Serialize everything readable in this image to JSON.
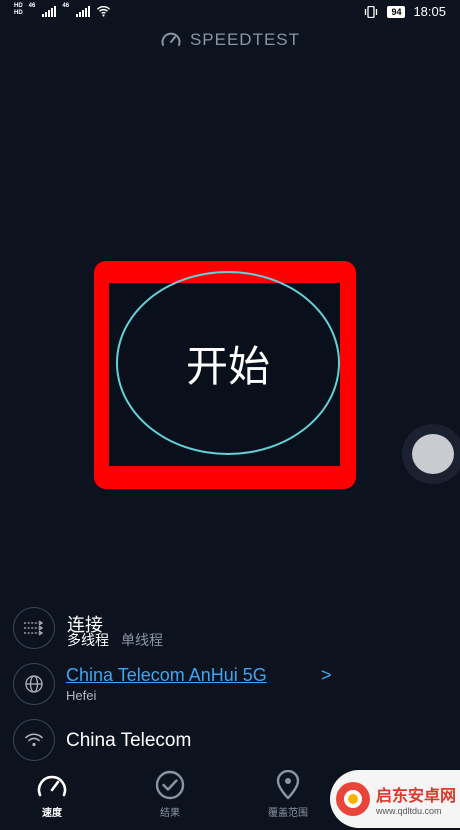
{
  "status_bar": {
    "network_left": [
      "HD",
      "46"
    ],
    "network_right": [
      "46"
    ],
    "battery": "94",
    "time": "18:05"
  },
  "brand": {
    "title": "SPEEDTEST",
    "icon": "gauge-icon"
  },
  "start_button": {
    "label": "开始",
    "ring_color": "#63d1d6"
  },
  "highlight_box_color": "#ff0000",
  "connection": {
    "title": "连接",
    "options": [
      {
        "label": "多线程",
        "active": true
      },
      {
        "label": "单线程",
        "active": false
      }
    ]
  },
  "server": {
    "name": "China Telecom AnHui 5G",
    "chevron": ">",
    "city": "Hefei",
    "link_color": "#3fa5ee"
  },
  "isp": {
    "name": "China Telecom"
  },
  "tabs": [
    {
      "label": "速度",
      "icon": "speed-gauge-icon",
      "active": true
    },
    {
      "label": "结果",
      "icon": "check-circle-icon",
      "active": false
    },
    {
      "label": "覆盖范围",
      "icon": "map-pin-icon",
      "active": false
    }
  ],
  "watermark": {
    "name": "启东安卓网",
    "url": "www.qdltdu.com"
  }
}
